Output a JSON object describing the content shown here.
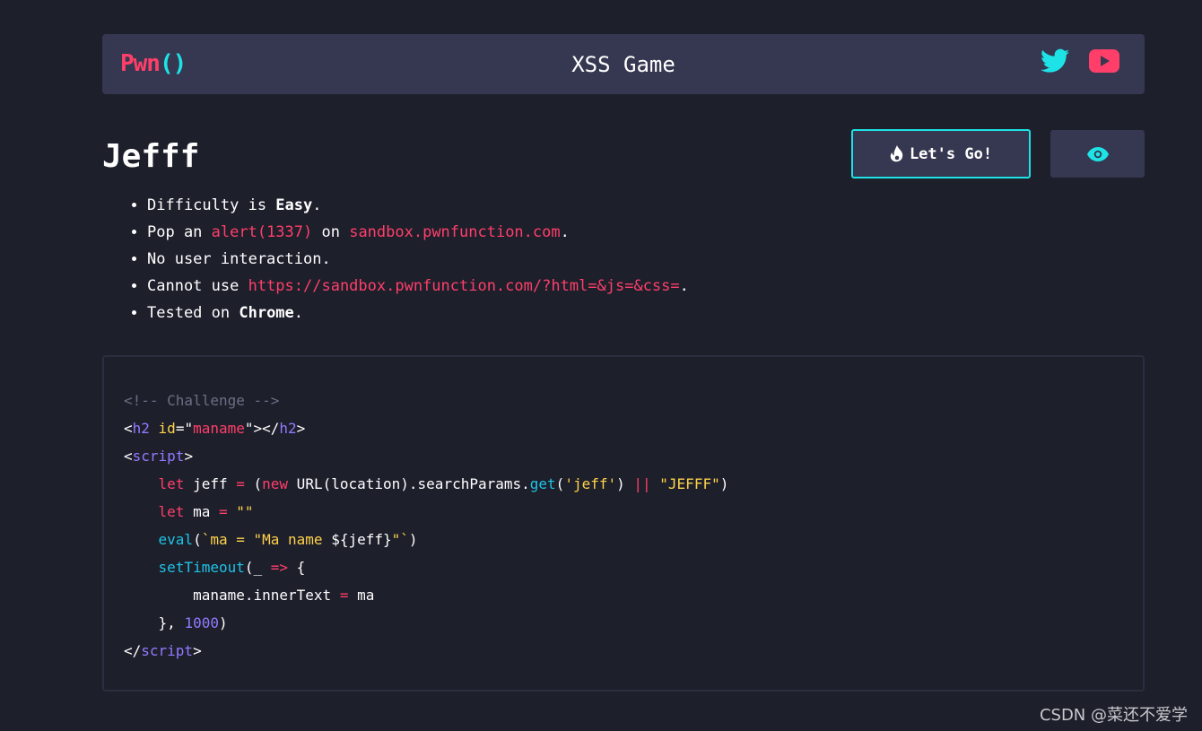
{
  "header": {
    "logo_main": "Pwn",
    "logo_paren": "()",
    "title": "XSS Game",
    "social": [
      "twitter-icon",
      "youtube-icon"
    ]
  },
  "challenge": {
    "title": "Jefff",
    "go_button_label": "Let's Go!"
  },
  "rules": [
    {
      "pre": "Difficulty is ",
      "bold": "Easy",
      "post": "."
    },
    {
      "pre": "Pop an ",
      "hl1": "alert(1337)",
      "mid": " on ",
      "hl2": "sandbox.pwnfunction.com",
      "post": "."
    },
    {
      "text": "No user interaction."
    },
    {
      "pre": "Cannot use ",
      "hl": "https://sandbox.pwnfunction.com/?html=&js=&css=",
      "post": "."
    },
    {
      "pre": "Tested on ",
      "bold": "Chrome",
      "post": "."
    }
  ],
  "code": {
    "comment": "<!-- Challenge -->",
    "h2_open_lt": "<",
    "h2_tag": "h2",
    "h2_attr": "id",
    "h2_eq": "=\"",
    "h2_val": "maname",
    "h2_mid": "\"></",
    "h2_close_tag": "h2",
    "gt": ">",
    "script_tag": "script",
    "l4_kw": "let",
    "l4_a": " jeff ",
    "l4_eq": "=",
    "l4_b": " (",
    "l4_new": "new",
    "l4_c": " URL(location).searchParams.",
    "l4_get": "get",
    "l4_d": "(",
    "l4_str": "'jeff'",
    "l4_e": ") ",
    "l4_or": "||",
    "l4_f": " ",
    "l4_str2": "\"JEFFF\"",
    "l4_g": ")",
    "l5_kw": "let",
    "l5_a": " ma ",
    "l5_eq": "=",
    "l5_b": " ",
    "l5_str": "\"\"",
    "l6_fn": "eval",
    "l6_a": "(",
    "l6_str1": "`ma = \"Ma name ",
    "l6_interp": "${jeff}",
    "l6_str2": "\"`",
    "l6_b": ")",
    "l7_fn": "setTimeout",
    "l7_a": "(_ ",
    "l7_arrow": "=>",
    "l7_b": " {",
    "l8_a": "maname.innerText ",
    "l8_eq": "=",
    "l8_b": " ma",
    "l9_a": "}, ",
    "l9_num": "1000",
    "l9_b": ")",
    "close_lt": "</"
  },
  "watermark": "CSDN @菜还不爱学",
  "colors": {
    "background": "#1d1f2b",
    "panel": "#353850",
    "accent_pink": "#ff3f6a",
    "accent_cyan": "#1ee3e6"
  }
}
